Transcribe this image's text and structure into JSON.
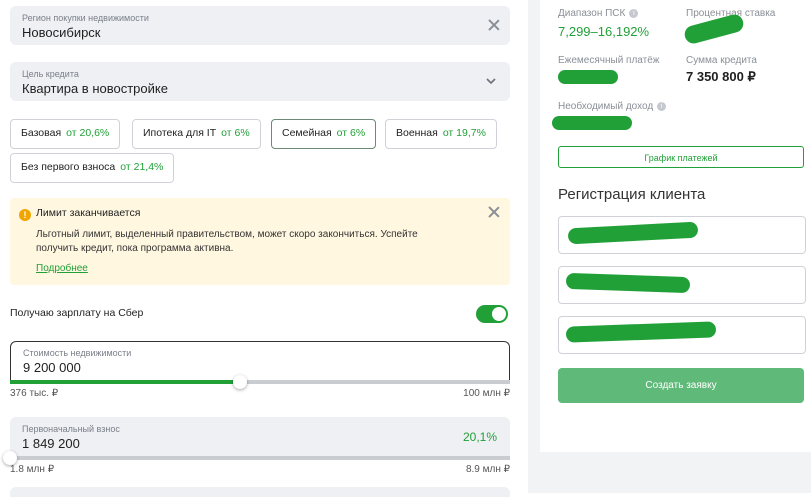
{
  "region": {
    "label": "Регион покупки недвижимости",
    "value": "Новосибирск"
  },
  "purpose": {
    "label": "Цель кредита",
    "value": "Квартира в новостройке"
  },
  "programs": [
    {
      "name": "Базовая",
      "rate": "от 20,6%"
    },
    {
      "name": "Ипотека для IT",
      "rate": "от 6%"
    },
    {
      "name": "Семейная",
      "rate": "от 6%"
    },
    {
      "name": "Военная",
      "rate": "от 19,7%"
    },
    {
      "name": "Без первого взноса",
      "rate": "от 21,4%"
    }
  ],
  "alert": {
    "title": "Лимит заканчивается",
    "body": "Льготный лимит, выделенный правительством, может скоро закончиться. Успейте получить кредит, пока программа активна.",
    "link": "Подробнее"
  },
  "salary": {
    "label": "Получаю зарплату на Сбер",
    "on": true
  },
  "price": {
    "label": "Стоимость недвижимости",
    "value": "9 200 000",
    "min": "376 тыс. ₽",
    "max": "100 млн ₽",
    "fill_percent": 46
  },
  "downpayment": {
    "label": "Первоначальный взнос",
    "value": "1 849 200",
    "percent": "20,1%",
    "min": "1.8 млн ₽",
    "max": "8.9 млн ₽",
    "fill_percent": 0
  },
  "summary": {
    "psk_label": "Диапазон ПСК",
    "psk_value": "7,299–16,192%",
    "rate_label": "Процентная ставка",
    "monthly_label": "Ежемесячный платёж",
    "credit_label": "Сумма кредита",
    "credit_value": "7 350 800 ₽",
    "income_label": "Необходимый доход",
    "schedule_button": "График платежей"
  },
  "registration": {
    "title": "Регистрация клиента",
    "submit": "Создать заявку"
  },
  "colors": {
    "accent": "#21a038",
    "field_bg": "#eef0f4",
    "alert_bg": "#fff7e0"
  }
}
